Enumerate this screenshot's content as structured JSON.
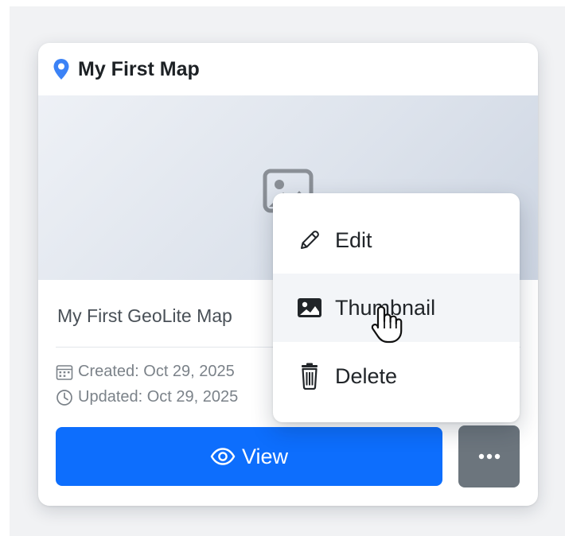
{
  "card": {
    "title": "My First Map",
    "description": "My First GeoLite Map",
    "created": "Created: Oct 29, 2025",
    "updated": "Updated: Oct 29, 2025",
    "view_label": "View",
    "more_label": "•••"
  },
  "menu": {
    "items": [
      {
        "label": "Edit",
        "icon": "pencil-icon"
      },
      {
        "label": "Thumbnail",
        "icon": "image-icon"
      },
      {
        "label": "Delete",
        "icon": "trash-icon"
      }
    ],
    "hovered": "Thumbnail"
  },
  "colors": {
    "primary": "#0d6efd",
    "secondary": "#6c757d",
    "pin": "#3b82f6",
    "title_text": "#1d2125",
    "muted_text": "#7b8289",
    "hover_bg": "#f3f5f8"
  }
}
